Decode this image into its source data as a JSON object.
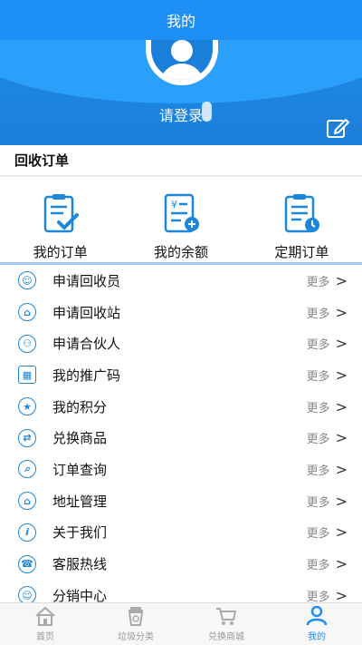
{
  "header": {
    "title": "我的"
  },
  "profile": {
    "login_label": "请登录",
    "edit_icon": "edit-icon"
  },
  "orders": {
    "title": "回收订单",
    "items": [
      {
        "label": "我的订单",
        "icon": "order-clipboard-icon"
      },
      {
        "label": "我的余额",
        "icon": "balance-document-icon"
      },
      {
        "label": "定期订单",
        "icon": "scheduled-order-icon"
      }
    ]
  },
  "menu": {
    "more_label": "更多",
    "items": [
      {
        "label": "申请回收员",
        "icon": "person-icon"
      },
      {
        "label": "申请回收站",
        "icon": "home-icon"
      },
      {
        "label": "申请合伙人",
        "icon": "partner-icon"
      },
      {
        "label": "我的推广码",
        "icon": "qrcode-icon"
      },
      {
        "label": "我的积分",
        "icon": "points-icon"
      },
      {
        "label": "兑换商品",
        "icon": "exchange-icon"
      },
      {
        "label": "订单查询",
        "icon": "order-search-icon"
      },
      {
        "label": "地址管理",
        "icon": "address-icon"
      },
      {
        "label": "关于我们",
        "icon": "info-icon"
      },
      {
        "label": "客服热线",
        "icon": "service-icon"
      },
      {
        "label": "分销中心",
        "icon": "distribution-icon"
      }
    ]
  },
  "bottom_nav": {
    "items": [
      {
        "label": "首页",
        "icon": "home-icon"
      },
      {
        "label": "垃圾分类",
        "icon": "trash-icon"
      },
      {
        "label": "兑换商城",
        "icon": "cart-icon"
      },
      {
        "label": "我的",
        "icon": "user-icon"
      }
    ],
    "active_index": 3
  },
  "colors": {
    "primary": "#1e8ff5",
    "accent_dark": "#1c86d8"
  }
}
